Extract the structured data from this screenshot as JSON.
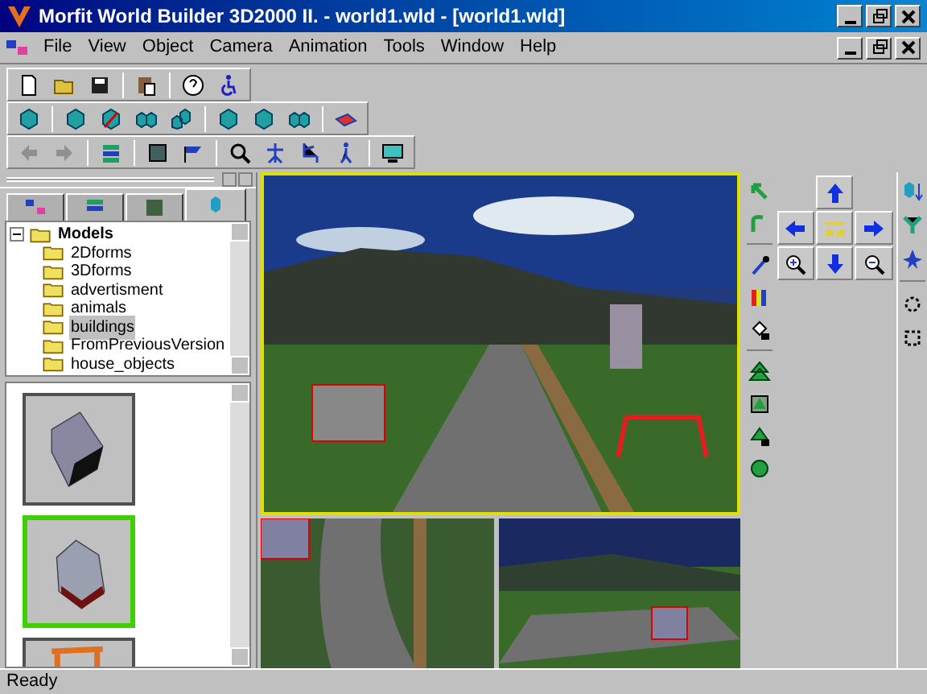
{
  "window": {
    "title": "Morfit World Builder 3D2000 II. - world1.wld - [world1.wld]"
  },
  "menu": [
    "File",
    "View",
    "Object",
    "Camera",
    "Animation",
    "Tools",
    "Window",
    "Help"
  ],
  "panel_tabs": [
    {
      "selected": false
    },
    {
      "selected": false
    },
    {
      "selected": false
    },
    {
      "selected": true
    }
  ],
  "tree": [
    {
      "label": "Models",
      "expanded": true,
      "children": [
        {
          "label": "2Dforms",
          "selected": false
        },
        {
          "label": "3Dforms",
          "selected": false
        },
        {
          "label": "advertisment",
          "selected": false
        },
        {
          "label": "animals",
          "selected": false
        },
        {
          "label": "buildings",
          "selected": true
        },
        {
          "label": "FromPreviousVersion",
          "selected": false
        },
        {
          "label": "house_objects",
          "selected": false
        }
      ]
    }
  ],
  "thumbnails": [
    {
      "kind": "block",
      "selected": false
    },
    {
      "kind": "house",
      "selected": true
    },
    {
      "kind": "frame",
      "selected": false
    }
  ],
  "status_bar": "Ready"
}
